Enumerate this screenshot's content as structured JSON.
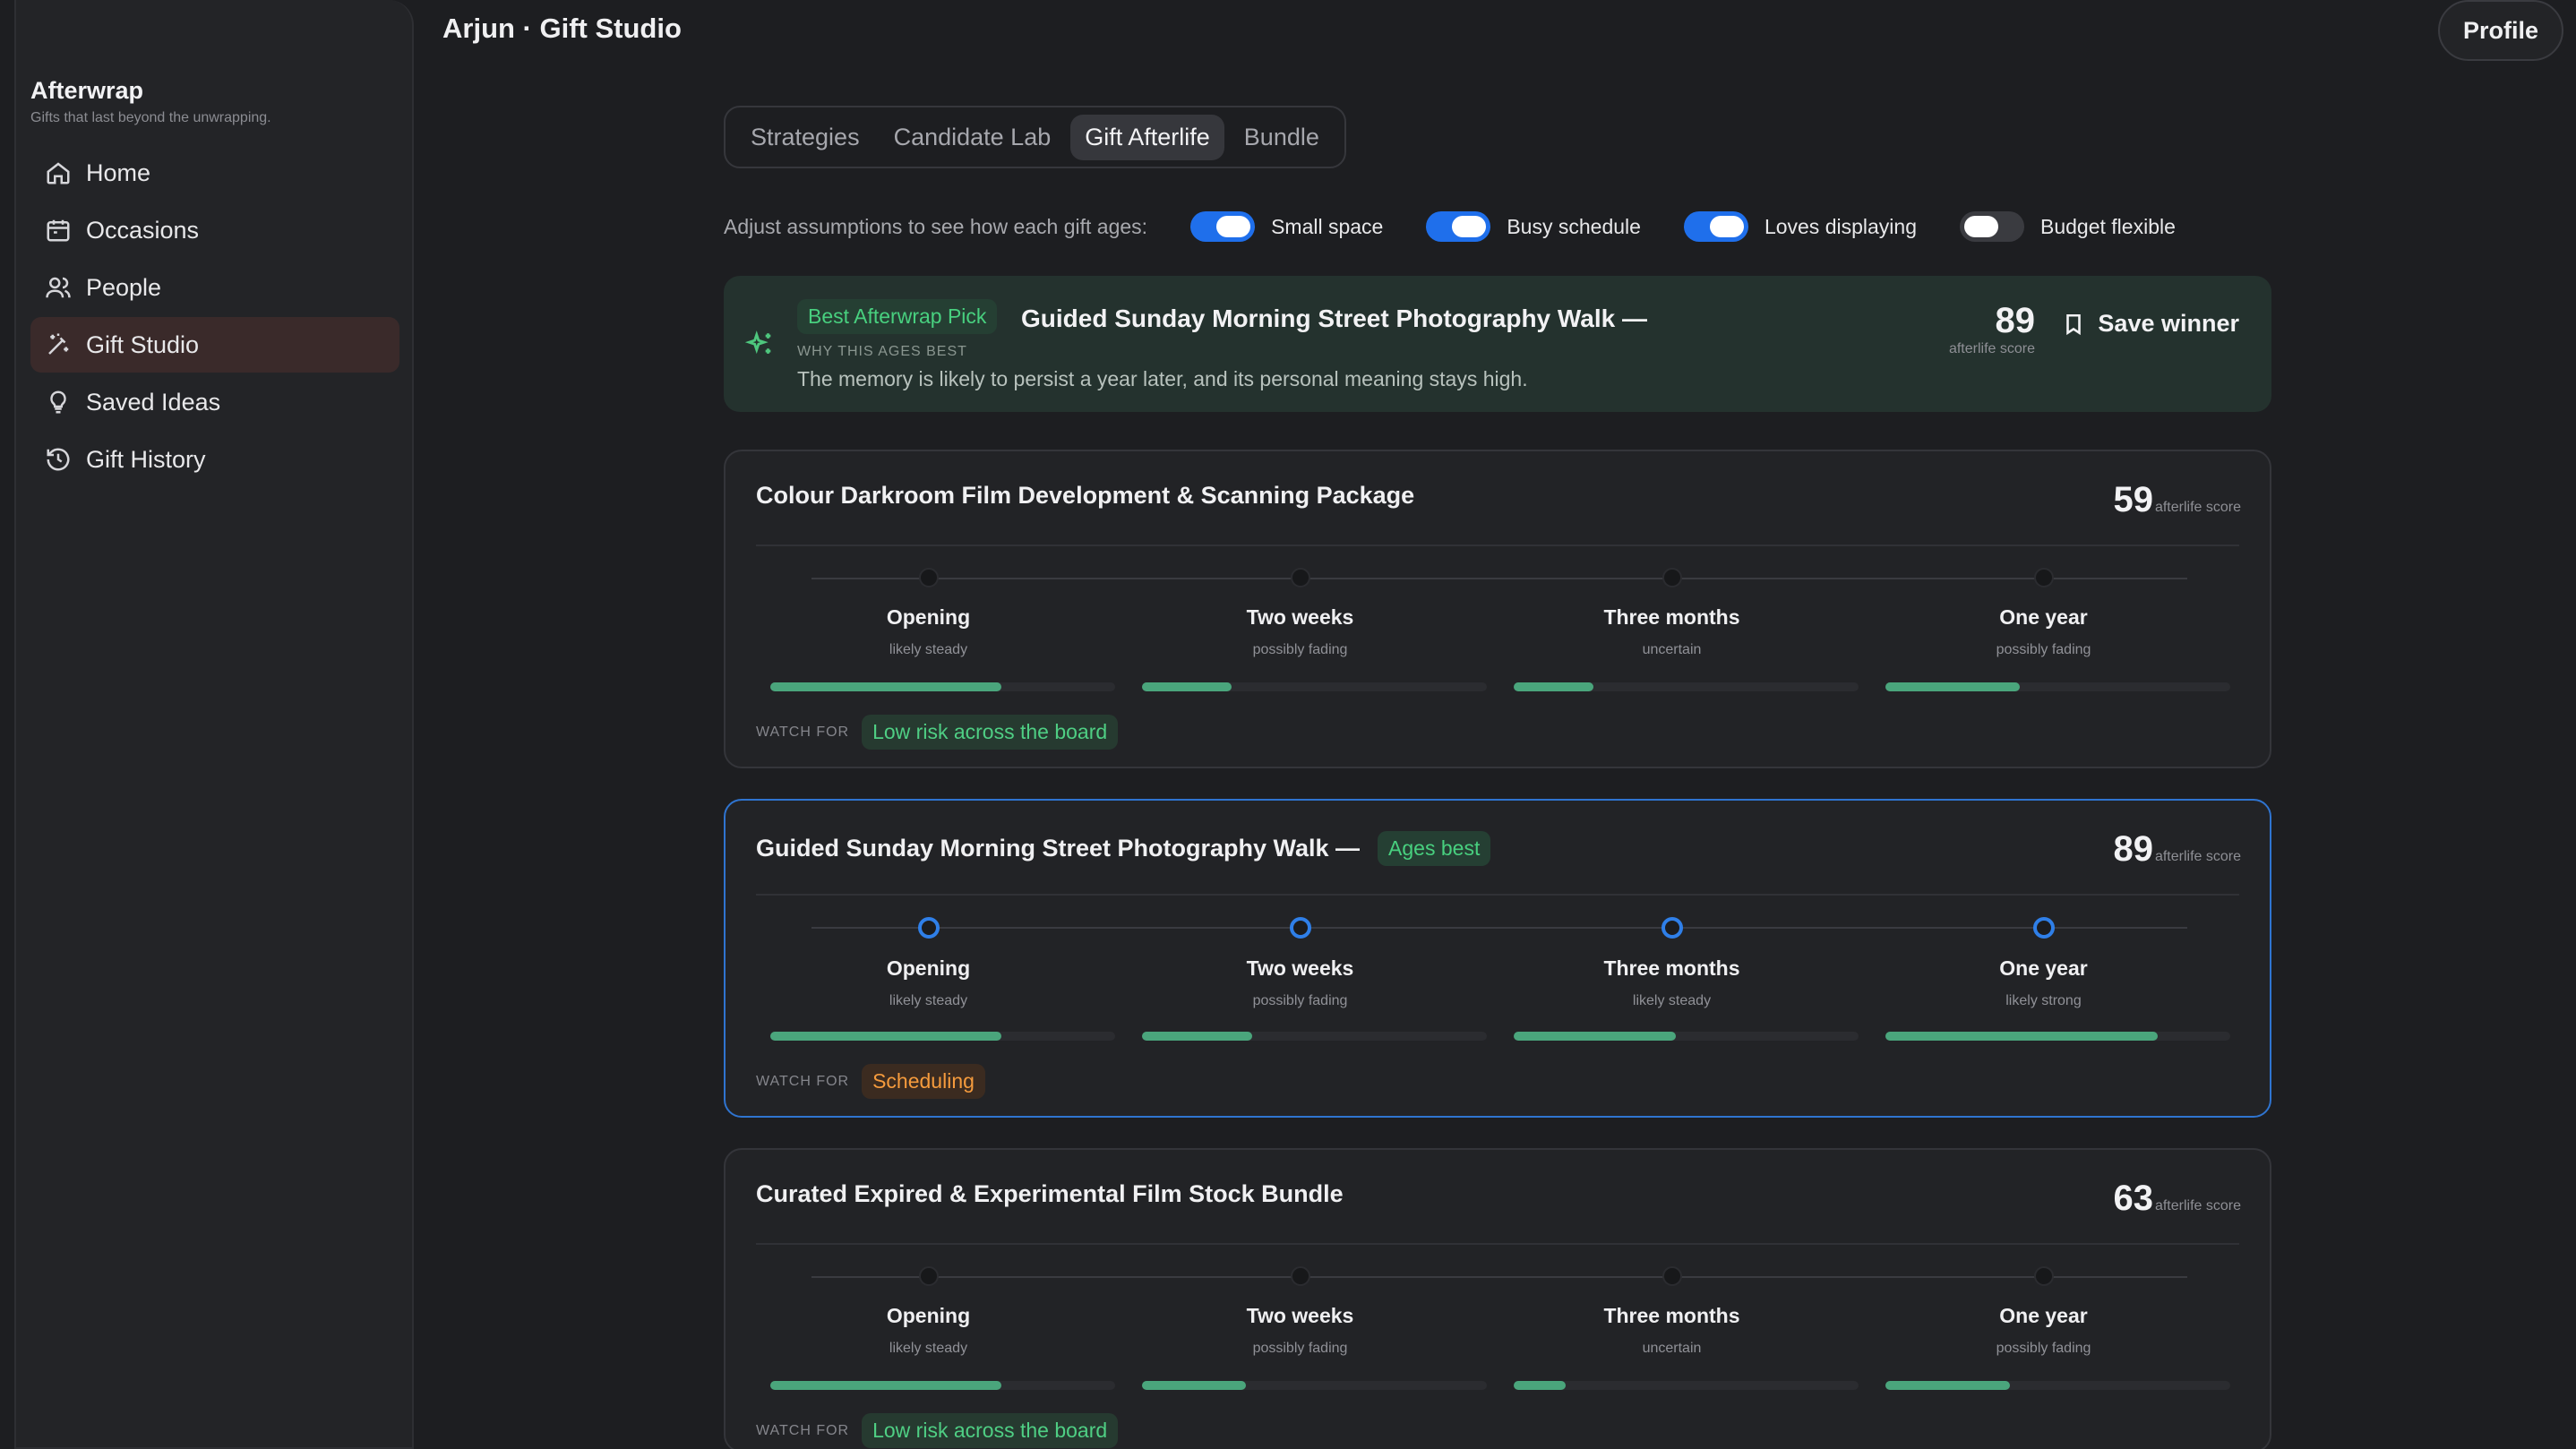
{
  "app": {
    "name": "Afterwrap",
    "tagline": "Gifts that last beyond the unwrapping."
  },
  "sidebar": {
    "items": [
      {
        "label": "Home",
        "icon": "home-icon",
        "active": false
      },
      {
        "label": "Occasions",
        "icon": "calendar-icon",
        "active": false
      },
      {
        "label": "People",
        "icon": "people-icon",
        "active": false
      },
      {
        "label": "Gift Studio",
        "icon": "magic-wand-icon",
        "active": true
      },
      {
        "label": "Saved Ideas",
        "icon": "lightbulb-icon",
        "active": false
      },
      {
        "label": "Gift History",
        "icon": "history-icon",
        "active": false
      }
    ]
  },
  "header": {
    "title": "Arjun · Gift Studio",
    "profile_label": "Profile"
  },
  "tabs": [
    {
      "label": "Strategies",
      "active": false
    },
    {
      "label": "Candidate Lab",
      "active": false
    },
    {
      "label": "Gift Afterlife",
      "active": true
    },
    {
      "label": "Bundle",
      "active": false
    }
  ],
  "assumptions": {
    "label": "Adjust assumptions to see how each gift ages:",
    "toggles": [
      {
        "label": "Small space",
        "on": true
      },
      {
        "label": "Busy schedule",
        "on": true
      },
      {
        "label": "Loves displaying",
        "on": true
      },
      {
        "label": "Budget flexible",
        "on": false
      }
    ]
  },
  "winner": {
    "badge": "Best Afterwrap Pick",
    "title": "Guided Sunday Morning Street Photography Walk —",
    "why_label": "WHY THIS AGES BEST",
    "description": "The memory is likely to persist a year later, and its personal meaning stays high.",
    "score": "89",
    "score_caption": "afterlife score",
    "save_label": "Save winner"
  },
  "watch_label": "WATCH FOR",
  "cards": [
    {
      "title": "Colour Darkroom Film Development & Scanning Package",
      "badge": "",
      "score": "59",
      "score_caption": "afterlife score",
      "selected": false,
      "stages": [
        {
          "name": "Opening",
          "status": "likely steady",
          "level": 0.67
        },
        {
          "name": "Two weeks",
          "status": "possibly fading",
          "level": 0.26
        },
        {
          "name": "Three months",
          "status": "uncertain",
          "level": 0.23
        },
        {
          "name": "One year",
          "status": "possibly fading",
          "level": 0.39
        }
      ],
      "watch": "Low risk across the board",
      "watch_tone": "green"
    },
    {
      "title": "Guided Sunday Morning Street Photography Walk —",
      "badge": "Ages best",
      "score": "89",
      "score_caption": "afterlife score",
      "selected": true,
      "stages": [
        {
          "name": "Opening",
          "status": "likely steady",
          "level": 0.67
        },
        {
          "name": "Two weeks",
          "status": "possibly fading",
          "level": 0.32
        },
        {
          "name": "Three months",
          "status": "likely steady",
          "level": 0.47
        },
        {
          "name": "One year",
          "status": "likely strong",
          "level": 0.79
        }
      ],
      "watch": "Scheduling",
      "watch_tone": "orange"
    },
    {
      "title": "Curated Expired & Experimental Film Stock Bundle",
      "badge": "",
      "score": "63",
      "score_caption": "afterlife score",
      "selected": false,
      "stages": [
        {
          "name": "Opening",
          "status": "likely steady",
          "level": 0.67
        },
        {
          "name": "Two weeks",
          "status": "possibly fading",
          "level": 0.3
        },
        {
          "name": "Three months",
          "status": "uncertain",
          "level": 0.15
        },
        {
          "name": "One year",
          "status": "possibly fading",
          "level": 0.36
        }
      ],
      "watch": "Low risk across the board",
      "watch_tone": "green"
    }
  ],
  "colors": {
    "accent": "#1f6feb",
    "positive": "#48d07f",
    "warning": "#f59b3d",
    "bar": "#4aa57c"
  }
}
